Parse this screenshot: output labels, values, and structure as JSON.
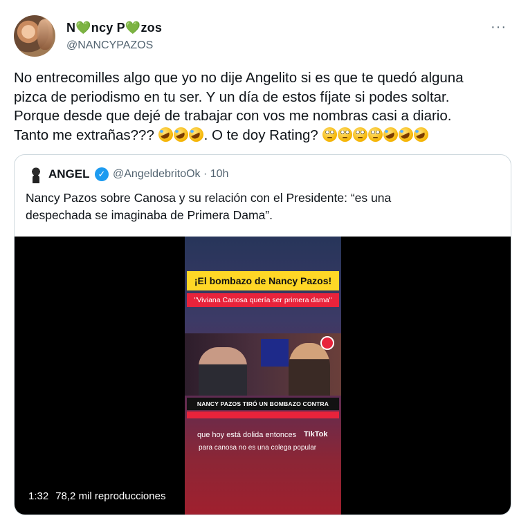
{
  "author": {
    "name": "N💚ncy P💚zos",
    "handle": "@NANCYPAZOS",
    "more_icon": "more-dots-icon"
  },
  "tweet": {
    "text": "No entrecomilles algo que yo no dije Angelito si es que te quedó alguna\npizca de periodismo en tu ser. Y un día de estos fíjate si podes soltar.\nPorque desde que dejé de trabajar con vos me nombras casi a diario.\nTanto me extrañas???",
    "text_tail_1": ". O te doy Rating? ",
    "emojis_a": [
      "rofl",
      "rofl",
      "rofl"
    ],
    "emojis_b": [
      "eyes",
      "eyes",
      "eyes",
      "eyes",
      "rofl",
      "rofl",
      "rofl"
    ]
  },
  "quoted": {
    "name": "ANGEL",
    "verified": true,
    "handle_time": "@AngeldebritoOk · 10h",
    "text": "Nancy Pazos sobre Canosa y su relación con el Presidente: “es una\ndespechada se imaginaba de Primera Dama”.",
    "video": {
      "banner_title": "¡El bombazo de Nancy Pazos!",
      "banner_quote": "\"Viviana Canosa quería ser primera dama\"",
      "lower_third": "NANCY PAZOS TIRÓ UN BOMBAZO CONTRA CANOSA",
      "subtitle_1": "que hoy está dolida entonces",
      "subtitle_2": "para canosa no es una colega popular",
      "watermark": "TikTok",
      "duration": "1:32",
      "views": "78,2 mil reproducciones"
    }
  },
  "colors": {
    "text": "#0f1419",
    "secondary": "#536471",
    "border": "#cfd9de",
    "verified": "#1d9bf0"
  }
}
